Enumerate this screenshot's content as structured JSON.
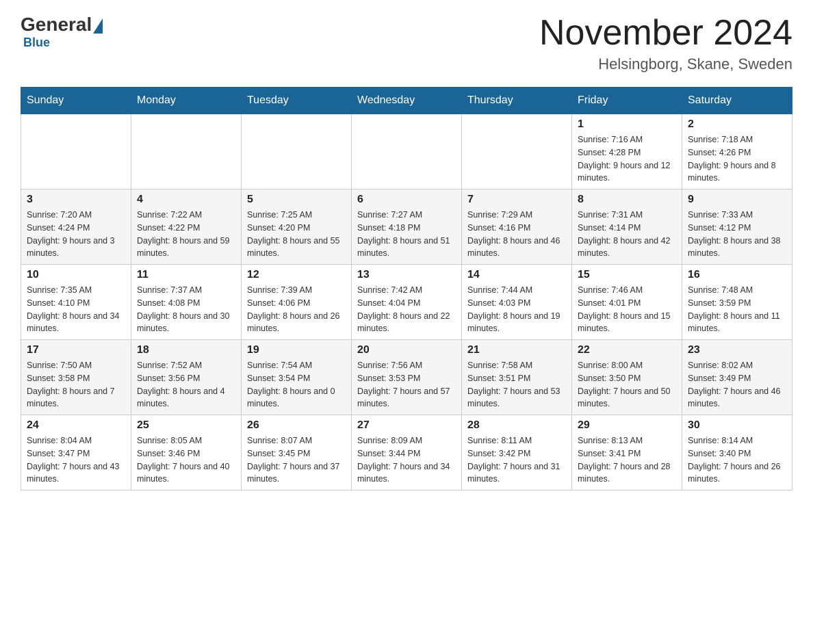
{
  "header": {
    "logo": {
      "general": "General",
      "blue": "Blue"
    },
    "title": "November 2024",
    "location": "Helsingborg, Skane, Sweden"
  },
  "days_of_week": [
    "Sunday",
    "Monday",
    "Tuesday",
    "Wednesday",
    "Thursday",
    "Friday",
    "Saturday"
  ],
  "weeks": [
    [
      {
        "day": "",
        "info": ""
      },
      {
        "day": "",
        "info": ""
      },
      {
        "day": "",
        "info": ""
      },
      {
        "day": "",
        "info": ""
      },
      {
        "day": "",
        "info": ""
      },
      {
        "day": "1",
        "info": "Sunrise: 7:16 AM\nSunset: 4:28 PM\nDaylight: 9 hours and 12 minutes."
      },
      {
        "day": "2",
        "info": "Sunrise: 7:18 AM\nSunset: 4:26 PM\nDaylight: 9 hours and 8 minutes."
      }
    ],
    [
      {
        "day": "3",
        "info": "Sunrise: 7:20 AM\nSunset: 4:24 PM\nDaylight: 9 hours and 3 minutes."
      },
      {
        "day": "4",
        "info": "Sunrise: 7:22 AM\nSunset: 4:22 PM\nDaylight: 8 hours and 59 minutes."
      },
      {
        "day": "5",
        "info": "Sunrise: 7:25 AM\nSunset: 4:20 PM\nDaylight: 8 hours and 55 minutes."
      },
      {
        "day": "6",
        "info": "Sunrise: 7:27 AM\nSunset: 4:18 PM\nDaylight: 8 hours and 51 minutes."
      },
      {
        "day": "7",
        "info": "Sunrise: 7:29 AM\nSunset: 4:16 PM\nDaylight: 8 hours and 46 minutes."
      },
      {
        "day": "8",
        "info": "Sunrise: 7:31 AM\nSunset: 4:14 PM\nDaylight: 8 hours and 42 minutes."
      },
      {
        "day": "9",
        "info": "Sunrise: 7:33 AM\nSunset: 4:12 PM\nDaylight: 8 hours and 38 minutes."
      }
    ],
    [
      {
        "day": "10",
        "info": "Sunrise: 7:35 AM\nSunset: 4:10 PM\nDaylight: 8 hours and 34 minutes."
      },
      {
        "day": "11",
        "info": "Sunrise: 7:37 AM\nSunset: 4:08 PM\nDaylight: 8 hours and 30 minutes."
      },
      {
        "day": "12",
        "info": "Sunrise: 7:39 AM\nSunset: 4:06 PM\nDaylight: 8 hours and 26 minutes."
      },
      {
        "day": "13",
        "info": "Sunrise: 7:42 AM\nSunset: 4:04 PM\nDaylight: 8 hours and 22 minutes."
      },
      {
        "day": "14",
        "info": "Sunrise: 7:44 AM\nSunset: 4:03 PM\nDaylight: 8 hours and 19 minutes."
      },
      {
        "day": "15",
        "info": "Sunrise: 7:46 AM\nSunset: 4:01 PM\nDaylight: 8 hours and 15 minutes."
      },
      {
        "day": "16",
        "info": "Sunrise: 7:48 AM\nSunset: 3:59 PM\nDaylight: 8 hours and 11 minutes."
      }
    ],
    [
      {
        "day": "17",
        "info": "Sunrise: 7:50 AM\nSunset: 3:58 PM\nDaylight: 8 hours and 7 minutes."
      },
      {
        "day": "18",
        "info": "Sunrise: 7:52 AM\nSunset: 3:56 PM\nDaylight: 8 hours and 4 minutes."
      },
      {
        "day": "19",
        "info": "Sunrise: 7:54 AM\nSunset: 3:54 PM\nDaylight: 8 hours and 0 minutes."
      },
      {
        "day": "20",
        "info": "Sunrise: 7:56 AM\nSunset: 3:53 PM\nDaylight: 7 hours and 57 minutes."
      },
      {
        "day": "21",
        "info": "Sunrise: 7:58 AM\nSunset: 3:51 PM\nDaylight: 7 hours and 53 minutes."
      },
      {
        "day": "22",
        "info": "Sunrise: 8:00 AM\nSunset: 3:50 PM\nDaylight: 7 hours and 50 minutes."
      },
      {
        "day": "23",
        "info": "Sunrise: 8:02 AM\nSunset: 3:49 PM\nDaylight: 7 hours and 46 minutes."
      }
    ],
    [
      {
        "day": "24",
        "info": "Sunrise: 8:04 AM\nSunset: 3:47 PM\nDaylight: 7 hours and 43 minutes."
      },
      {
        "day": "25",
        "info": "Sunrise: 8:05 AM\nSunset: 3:46 PM\nDaylight: 7 hours and 40 minutes."
      },
      {
        "day": "26",
        "info": "Sunrise: 8:07 AM\nSunset: 3:45 PM\nDaylight: 7 hours and 37 minutes."
      },
      {
        "day": "27",
        "info": "Sunrise: 8:09 AM\nSunset: 3:44 PM\nDaylight: 7 hours and 34 minutes."
      },
      {
        "day": "28",
        "info": "Sunrise: 8:11 AM\nSunset: 3:42 PM\nDaylight: 7 hours and 31 minutes."
      },
      {
        "day": "29",
        "info": "Sunrise: 8:13 AM\nSunset: 3:41 PM\nDaylight: 7 hours and 28 minutes."
      },
      {
        "day": "30",
        "info": "Sunrise: 8:14 AM\nSunset: 3:40 PM\nDaylight: 7 hours and 26 minutes."
      }
    ]
  ]
}
